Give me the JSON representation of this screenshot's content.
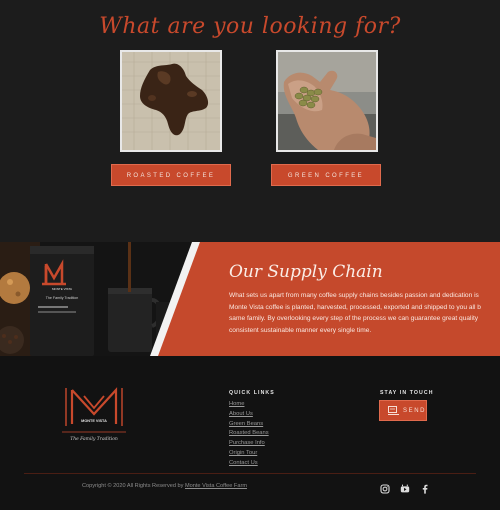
{
  "looking": {
    "title": "What are you looking for?",
    "cards": [
      {
        "image_alt": "roasted coffee beans shaped like map",
        "button_label": "ROASTED COFFEE"
      },
      {
        "image_alt": "green coffee beans in hand",
        "button_label": "GREEN COFFEE"
      }
    ]
  },
  "supply": {
    "title": "Our Supply Chain",
    "paragraph_lines": [
      "What sets us apart from many coffee supply chains besides passion and dedication is",
      "Monte Vista coffee is planted, harvested, processed, exported and shipped to you all b",
      "same family. By overlooking every step of the process we can guarantee great quality",
      "consistent sustainable manner every single time."
    ],
    "bag": {
      "brand": "MONTE VISTA",
      "tagline": "The Family Tradition"
    }
  },
  "footer": {
    "logo": {
      "brand": "MONTE VISTA",
      "tagline": "The Family Tradition"
    },
    "quick_links_title": "QUICK LINKS",
    "quick_links": [
      "Home",
      "About Us",
      "Green Beans",
      "Roasted Beans",
      "Purchase Info",
      "Origin Tour",
      "Contact Us"
    ],
    "stay_title": "STAY IN TOUCH",
    "send_label": "SEND",
    "copyright_prefix": "Copyright © 2020 All Rights Reserved by ",
    "copyright_link": "Monte Vista Coffee Farm",
    "social_icons": [
      "instagram-icon",
      "youtube-icon",
      "facebook-icon"
    ]
  },
  "colors": {
    "accent": "#c8492c",
    "dark": "#1c1c1c",
    "footer": "#121212"
  }
}
